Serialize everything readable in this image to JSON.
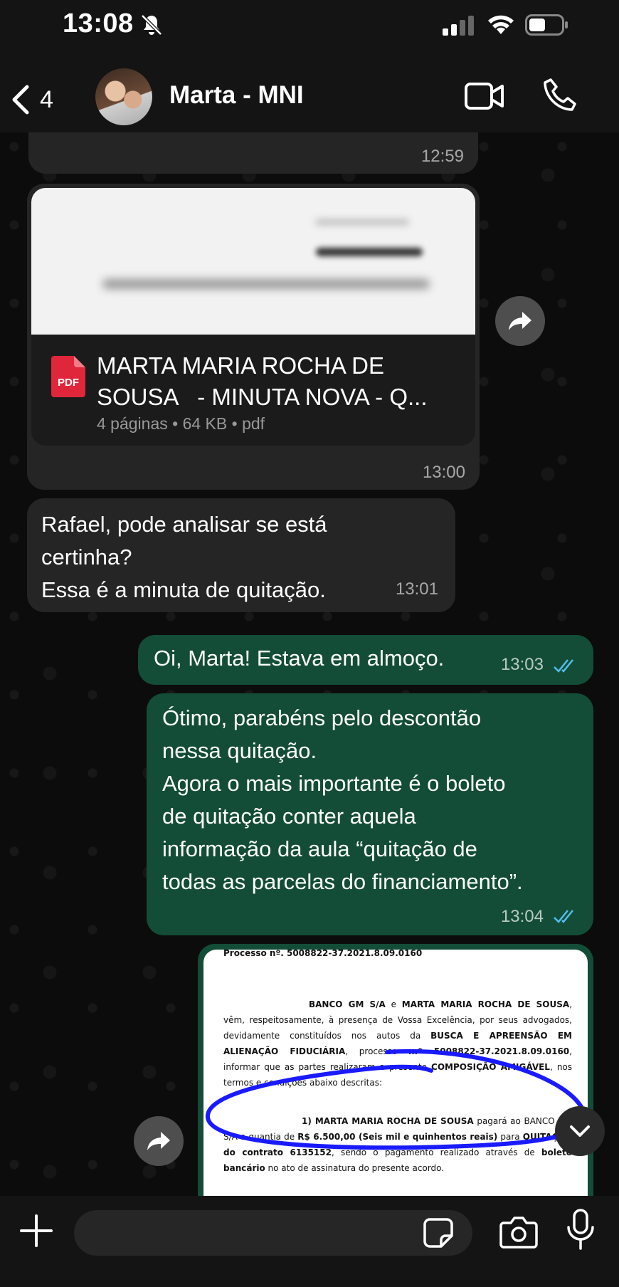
{
  "status_bar": {
    "time": "13:08"
  },
  "header": {
    "back_count": "4",
    "contact_name": "Marta - MNI"
  },
  "messages": {
    "partial": {
      "time": "12:59"
    },
    "document": {
      "file_name": "MARTA MARIA ROCHA DE\nSOUSA   - MINUTA NOVA - Q...",
      "meta": "4 páginas • 64 KB • pdf",
      "pdf_label": "PDF",
      "time": "13:00"
    },
    "incoming_text": {
      "text": "Rafael, pode analisar se está\ncertinha?\nEssa é a minuta de quitação.",
      "time": "13:01"
    },
    "outgoing_1": {
      "text": "Oi, Marta! Estava em almoço.",
      "time": "13:03"
    },
    "outgoing_2": {
      "text": "Ótimo, parabéns pelo descontão\nnessa quitação.\nAgora o mais importante é o boleto\nde quitação conter aquela\ninformação da aula “quitação de\ntodas as parcelas do financiamento”.",
      "time": "13:04"
    },
    "image_doc": {
      "line0": "Processo nº.  5008822-37.2021.8.09.0160",
      "para1_a": "BANCO GM S/A",
      "para1_b": " e ",
      "para1_c": "MARTA MARIA ROCHA DE SOUSA",
      "para1_d": ", vêm, respeitosamente, à presença de Vossa Excelência, por seus advogados, devidamente constituídos nos autos da ",
      "para1_e": "BUSCA E APREENSÃO EM ALIENAÇÃO FIDUCIÁRIA",
      "para1_f": ", processo ",
      "para1_g": "n.º 5008822-37.2021.8.09.0160",
      "para1_h": ", informar que as partes realizaram a presente ",
      "para1_i": "COMPOSIÇÃO AMIGÁVEL",
      "para1_j": ", nos termos e condições abaixo descritas:",
      "item1_a": "1) MARTA MARIA ROCHA DE SOUSA",
      "item1_b": " pagará ao BANCO GM S/A a quantia de ",
      "item1_c": "R$ 6.500,00 (Seis mil e quinhentos reais)",
      "item1_d": " para ",
      "item1_e": "QUITAÇÃO do contrato 6135152",
      "item1_f": ", sendo o pagamento realizado através de ",
      "item1_g": "boleto bancário",
      "item1_h": " no ato de assinatura do presente acordo."
    }
  },
  "input": {
    "placeholder": ""
  },
  "colors": {
    "outgoing_bubble": "#134d37",
    "incoming_bubble": "#252525",
    "read_ticks": "#53bdeb",
    "pen_mark": "#1a1aff"
  }
}
